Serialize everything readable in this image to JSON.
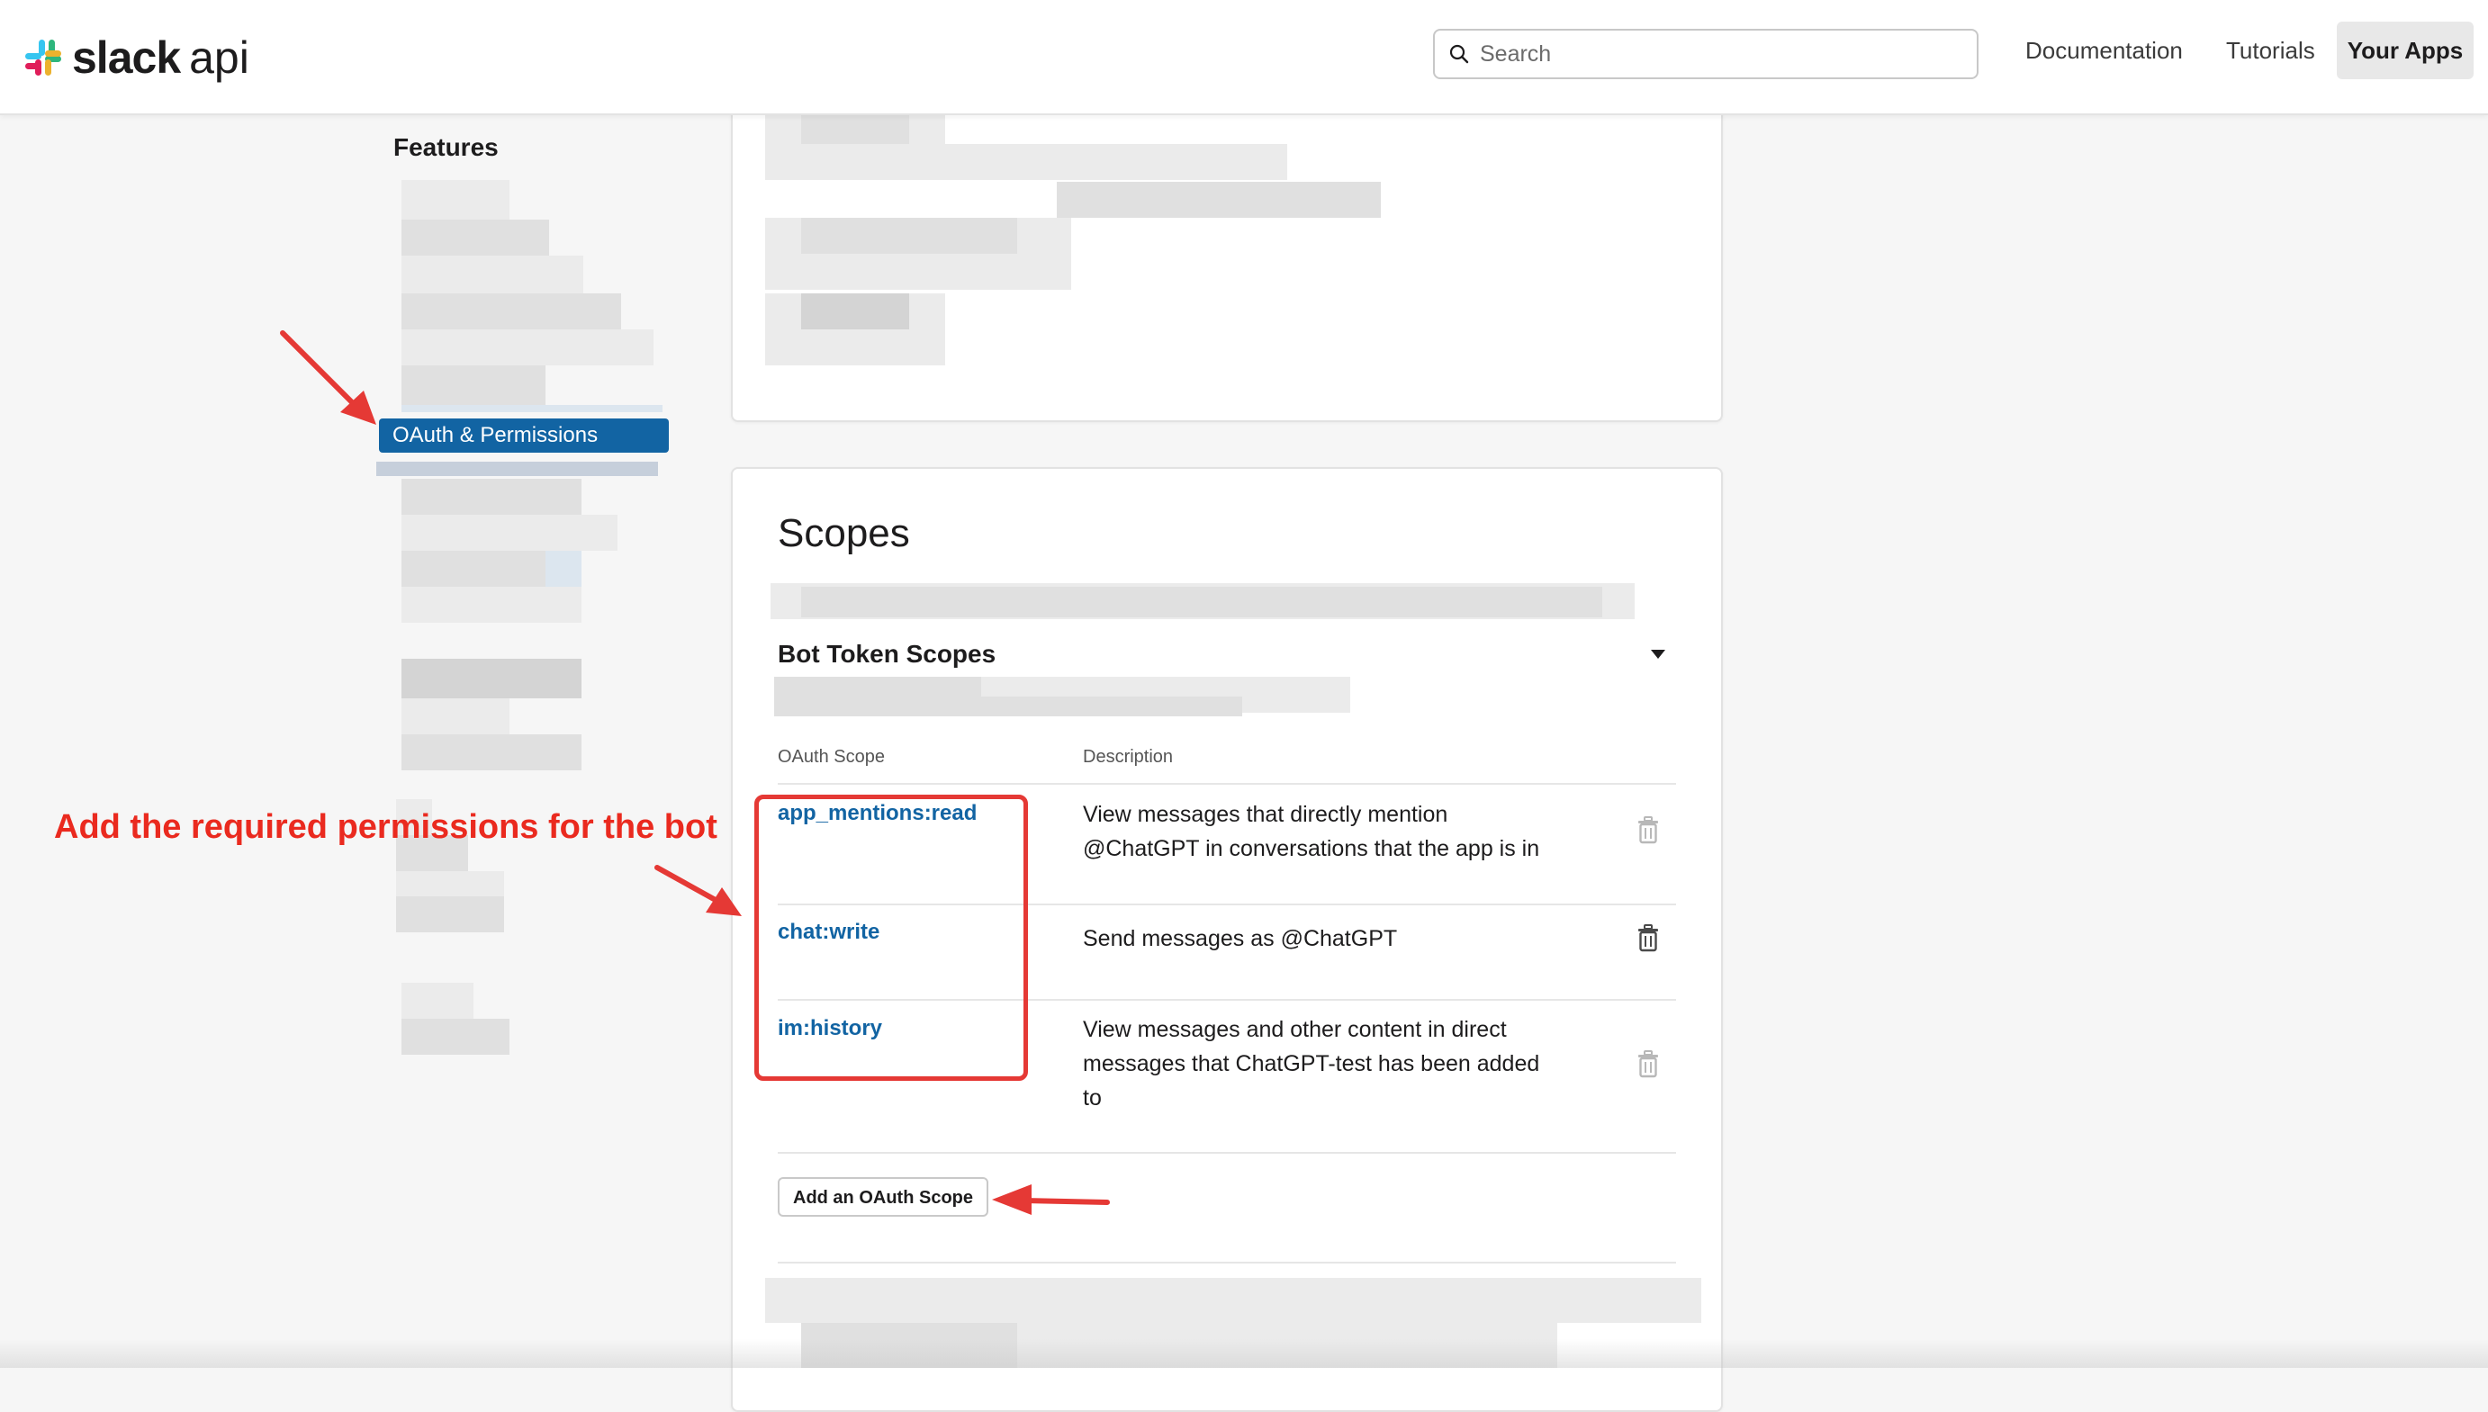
{
  "topbar": {
    "logo_slack": "slack",
    "logo_api": "api",
    "search_placeholder": "Search",
    "nav": {
      "documentation": "Documentation",
      "tutorials": "Tutorials",
      "your_apps": "Your Apps"
    }
  },
  "sidebar": {
    "heading": "Features",
    "active_item": "OAuth & Permissions"
  },
  "scopes": {
    "title": "Scopes",
    "section_title": "Bot Token Scopes",
    "columns": {
      "scope": "OAuth Scope",
      "description": "Description"
    },
    "rows": [
      {
        "scope": "app_mentions:read",
        "description": "View messages that directly mention @ChatGPT in conversations that the app is in"
      },
      {
        "scope": "chat:write",
        "description": "Send messages as @ChatGPT"
      },
      {
        "scope": "im:history",
        "description": "View messages and other content in direct messages that ChatGPT-test has been added to"
      }
    ],
    "add_button": "Add an OAuth Scope"
  },
  "annotation": {
    "text": "Add the required permissions for the bot",
    "color": "#ea2a1f"
  },
  "colors": {
    "accent": "#1264a3",
    "annotation_red": "#e53935"
  }
}
